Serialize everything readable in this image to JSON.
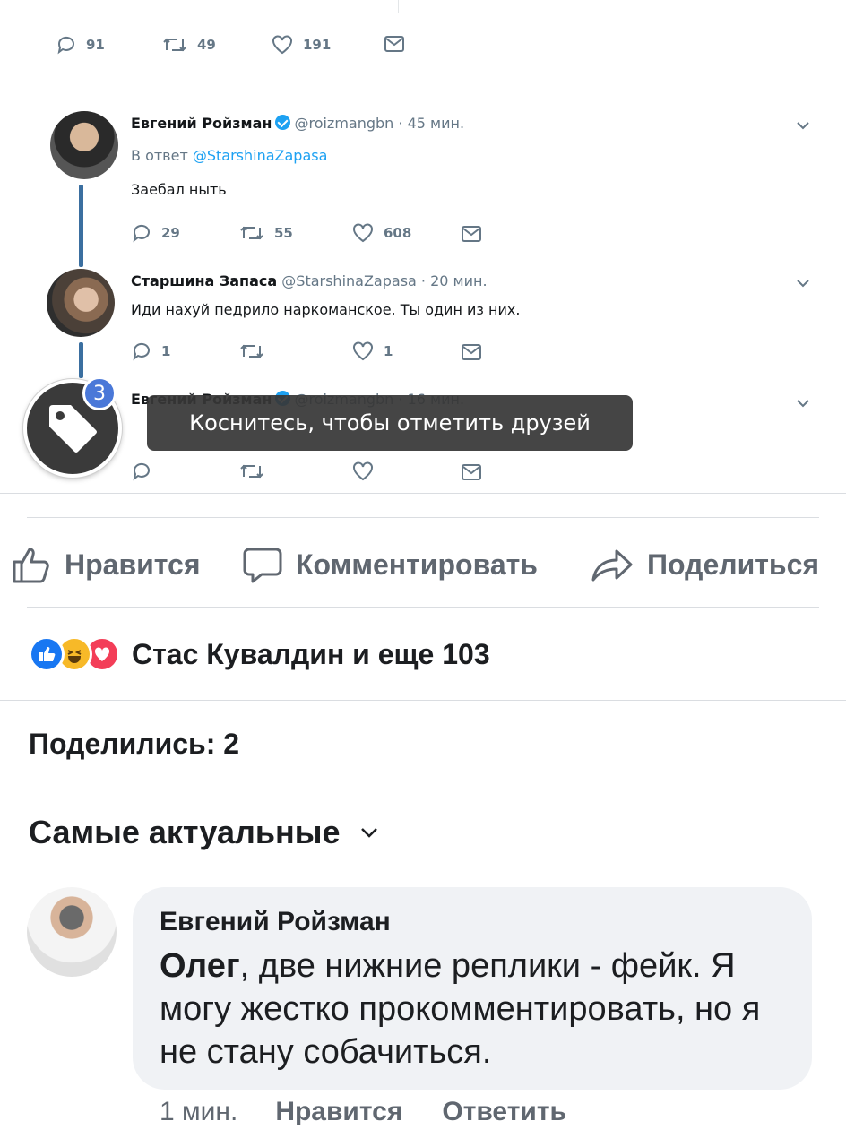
{
  "tweets": {
    "top_actions": {
      "replies": "91",
      "retweets": "49",
      "likes": "191"
    },
    "tweet1": {
      "name": "Евгений Ройзман",
      "handle_time": "@roizmangbn · 45 мин.",
      "reply_prefix": "В ответ",
      "reply_to": "@StarshinaZapasa",
      "text": "Заебал ныть",
      "replies": "29",
      "retweets": "55",
      "likes": "608"
    },
    "tweet2": {
      "name": "Старшина Запаса",
      "handle_time": "@StarshinaZapasa · 20 мин.",
      "text": "Иди нахуй педрило наркоманское. Ты один из них.",
      "replies": "1",
      "retweets": "",
      "likes": "1"
    },
    "tweet3": {
      "name": "Евгений Ройзман",
      "handle_time": "@roizmangbn · 16 мин."
    }
  },
  "tag_overlay": {
    "badge_count": "3",
    "tooltip": "Коснитесь, чтобы отметить друзей"
  },
  "post_actions": {
    "like": "Нравится",
    "comment": "Комментировать",
    "share": "Поделиться"
  },
  "reactions": {
    "summary": "Стас Кувалдин и еще 103"
  },
  "shares": "Поделились: 2",
  "sort": {
    "label": "Самые актуальные"
  },
  "comment": {
    "author": "Евгений Ройзман",
    "addressee": "Олег",
    "text": ", две нижние реплики - фейк. Я могу жестко прокомментировать, но я не стану собачиться.",
    "time": "1 мин.",
    "like": "Нравится",
    "reply": "Ответить"
  },
  "colors": {
    "twitter_blue": "#1da1f2",
    "fb_blue": "#1877f2",
    "haha_yellow": "#f7b928",
    "love_red": "#f33e58",
    "tooltip_bg": "#373737"
  }
}
